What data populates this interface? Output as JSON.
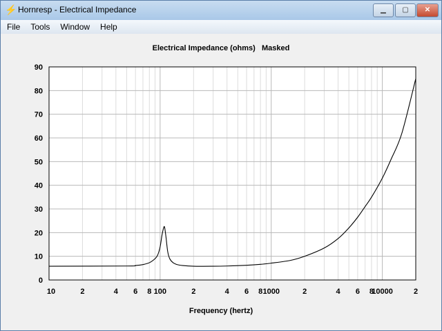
{
  "window": {
    "title": "Hornresp - Electrical Impedance",
    "min": "minimize",
    "max": "maximize",
    "close": "close"
  },
  "menu": [
    "File",
    "Tools",
    "Window",
    "Help"
  ],
  "chart_data": {
    "type": "line",
    "title": "Electrical Impedance (ohms)   Masked",
    "xlabel": "Frequency (hertz)",
    "ylabel": "",
    "xscale": "log",
    "xlim": [
      10,
      20000
    ],
    "ylim": [
      0,
      90
    ],
    "yticks": [
      0,
      10,
      20,
      30,
      40,
      50,
      60,
      70,
      80,
      90
    ],
    "xtick_labels": [
      {
        "v": 10,
        "t": "10"
      },
      {
        "v": 20,
        "t": "2"
      },
      {
        "v": 40,
        "t": "4"
      },
      {
        "v": 60,
        "t": "6"
      },
      {
        "v": 80,
        "t": "8"
      },
      {
        "v": 100,
        "t": "100"
      },
      {
        "v": 200,
        "t": "2"
      },
      {
        "v": 400,
        "t": "4"
      },
      {
        "v": 600,
        "t": "6"
      },
      {
        "v": 800,
        "t": "8"
      },
      {
        "v": 1000,
        "t": "1000"
      },
      {
        "v": 2000,
        "t": "2"
      },
      {
        "v": 4000,
        "t": "4"
      },
      {
        "v": 6000,
        "t": "6"
      },
      {
        "v": 8000,
        "t": "8"
      },
      {
        "v": 10000,
        "t": "10000"
      },
      {
        "v": 20000,
        "t": "2"
      }
    ],
    "grid": true,
    "series": [
      {
        "name": "Impedance",
        "x": [
          10,
          50,
          60,
          70,
          80,
          90,
          95,
          100,
          104,
          108,
          110,
          113,
          117,
          122,
          130,
          140,
          160,
          200,
          300,
          400,
          600,
          800,
          1000,
          1500,
          2000,
          3000,
          4000,
          5000,
          6000,
          7000,
          8000,
          10000,
          12000,
          15000,
          20000
        ],
        "y": [
          5.8,
          5.9,
          6.1,
          6.5,
          7.3,
          9,
          10.5,
          14,
          19,
          22.3,
          22,
          18,
          12,
          9,
          7.4,
          6.6,
          6.1,
          5.8,
          5.8,
          5.9,
          6.2,
          6.6,
          7.1,
          8.3,
          10,
          13.5,
          17.5,
          22,
          26.5,
          31,
          35,
          43,
          51,
          62,
          85
        ]
      }
    ]
  }
}
